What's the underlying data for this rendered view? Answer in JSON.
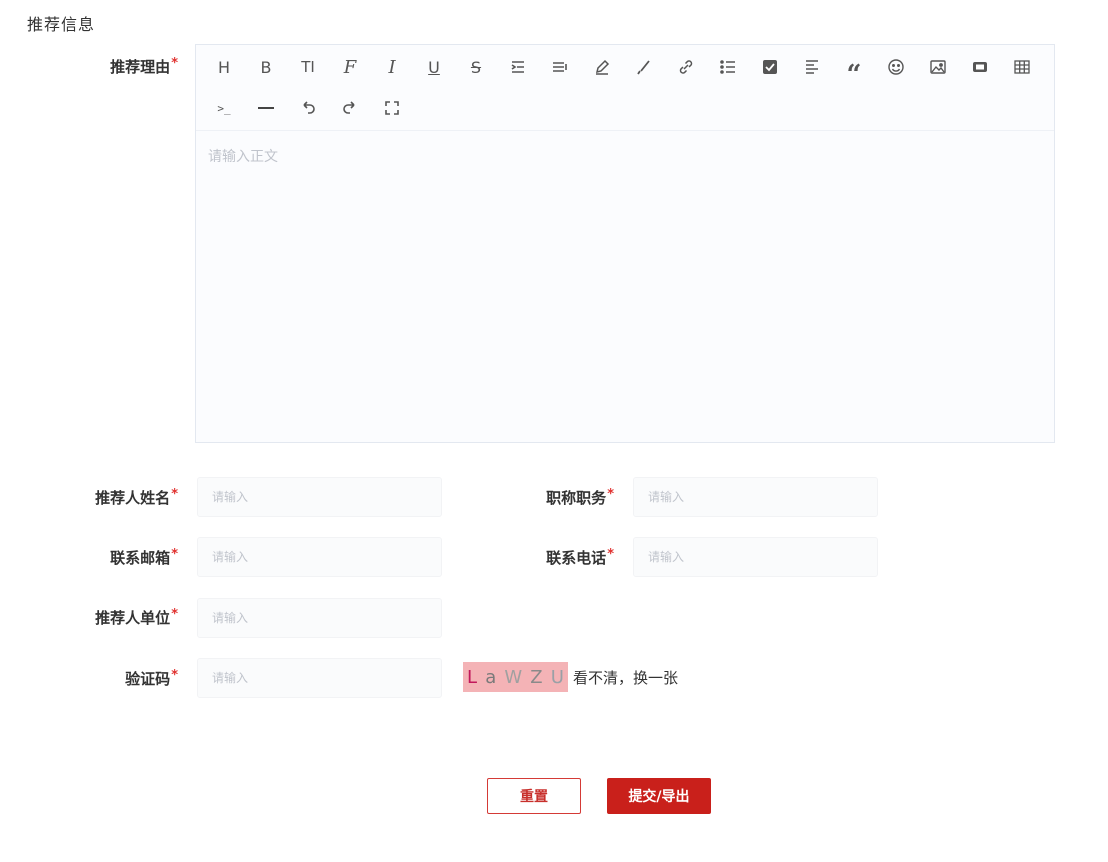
{
  "section": {
    "title": "推荐信息"
  },
  "reason": {
    "label": "推荐理由",
    "required_mark": "*",
    "placeholder": "请输入正文"
  },
  "toolbar": {
    "items": [
      {
        "icon": "heading-icon",
        "glyph": "H"
      },
      {
        "icon": "bold-icon",
        "glyph": "B"
      },
      {
        "icon": "font-size-icon",
        "glyph": "TI"
      },
      {
        "icon": "font-family-icon",
        "glyph": "F"
      },
      {
        "icon": "italic-icon",
        "glyph": "I"
      },
      {
        "icon": "underline-icon",
        "glyph": "U"
      },
      {
        "icon": "strikethrough-icon",
        "glyph": "S"
      },
      {
        "icon": "indent-icon",
        "glyph": ""
      },
      {
        "icon": "line-height-icon",
        "glyph": ""
      },
      {
        "icon": "font-color-icon",
        "glyph": ""
      },
      {
        "icon": "background-color-icon",
        "glyph": ""
      },
      {
        "icon": "link-icon",
        "glyph": ""
      },
      {
        "icon": "list-icon",
        "glyph": ""
      },
      {
        "icon": "todo-icon",
        "glyph": ""
      },
      {
        "icon": "align-icon",
        "glyph": ""
      },
      {
        "icon": "quote-icon",
        "glyph": "“"
      },
      {
        "icon": "emoji-icon",
        "glyph": ""
      },
      {
        "icon": "image-icon",
        "glyph": ""
      },
      {
        "icon": "video-icon",
        "glyph": ""
      },
      {
        "icon": "table-icon",
        "glyph": ""
      },
      {
        "icon": "code-icon",
        "glyph": ">_"
      },
      {
        "icon": "divider-icon",
        "glyph": ""
      },
      {
        "icon": "undo-icon",
        "glyph": ""
      },
      {
        "icon": "redo-icon",
        "glyph": ""
      },
      {
        "icon": "fullscreen-icon",
        "glyph": ""
      }
    ]
  },
  "fields": {
    "recommender_name": {
      "label": "推荐人姓名",
      "required_mark": "*",
      "placeholder": "请输入"
    },
    "title_position": {
      "label": "职称职务",
      "required_mark": "*",
      "placeholder": "请输入"
    },
    "email": {
      "label": "联系邮箱",
      "required_mark": "*",
      "placeholder": "请输入"
    },
    "phone": {
      "label": "联系电话",
      "required_mark": "*",
      "placeholder": "请输入"
    },
    "organization": {
      "label": "推荐人单位",
      "required_mark": "*",
      "placeholder": "请输入"
    },
    "captcha": {
      "label": "验证码",
      "required_mark": "*",
      "placeholder": "请输入"
    }
  },
  "captcha_image": {
    "chars": [
      "L",
      "a",
      "W",
      "Z",
      "U"
    ],
    "colors": [
      "#c2185b",
      "#7a7a7a",
      "#a0a0a0",
      "#8a8a8a",
      "#9aa0a6"
    ],
    "refresh_text": "看不清，换一张"
  },
  "actions": {
    "reset_label": "重置",
    "submit_label": "提交/导出",
    "primary_color": "#c9201b"
  }
}
